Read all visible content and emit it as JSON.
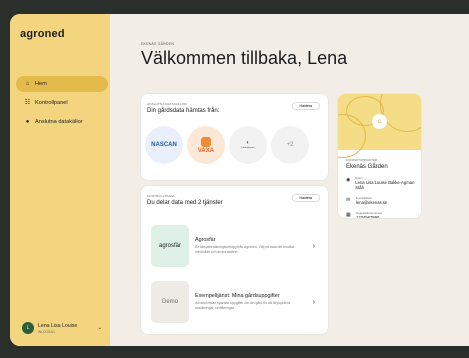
{
  "app": {
    "logo": "agroned"
  },
  "sidebar": {
    "items": [
      {
        "label": "Hem",
        "icon": "home-icon"
      },
      {
        "label": "Kontrollpanel",
        "icon": "control-panel-icon"
      },
      {
        "label": "Anslutna datakällor",
        "icon": "data-source-icon"
      }
    ],
    "user": {
      "initial": "L",
      "name": "Lena Lisa Louise",
      "status": "INLOGGAD"
    }
  },
  "main": {
    "eyebrow": "EKENÄS GÅRDEN",
    "title": "Välkommen tillbaka, Lena",
    "sources_card": {
      "eyebrow": "ANSLUTNA DATAKÄLLOR",
      "title": "Din gårdsdata hämtas från:",
      "manage": "Hantera",
      "sources": [
        "NASCAN",
        "VAXA",
        "Lantmännen",
        "+2"
      ]
    },
    "services_card": {
      "eyebrow": "KONTROLLPANEL",
      "title": "Du delar data med 2 tjänster",
      "manage": "Hantera",
      "services": [
        {
          "thumb": "agrosfär",
          "title": "Agrosfär",
          "desc": "Ett klimatberäkningsverktyg från Agroned. Välj ett data ditt resultat med både och andra aktörer."
        },
        {
          "thumb": "Demo",
          "title": "Exempeltjänst: Mina gårdsuppgifter",
          "desc": "Använd redan sparade uppgifter om din gård för att förpopulera ansökningar, certifieringar..."
        }
      ]
    },
    "contact_card": {
      "eyebrow": "KONTAKTUPPGIFTER",
      "title": "Ekenäs Gården",
      "rows": [
        {
          "label": "Namn",
          "value": "Lena Lisa Louise Bakke-Agman Ståh"
        },
        {
          "label": "E-postadress",
          "value": "lena@ekenas.se"
        },
        {
          "label": "Organisationsnummer",
          "value": "1234567890"
        }
      ]
    }
  }
}
